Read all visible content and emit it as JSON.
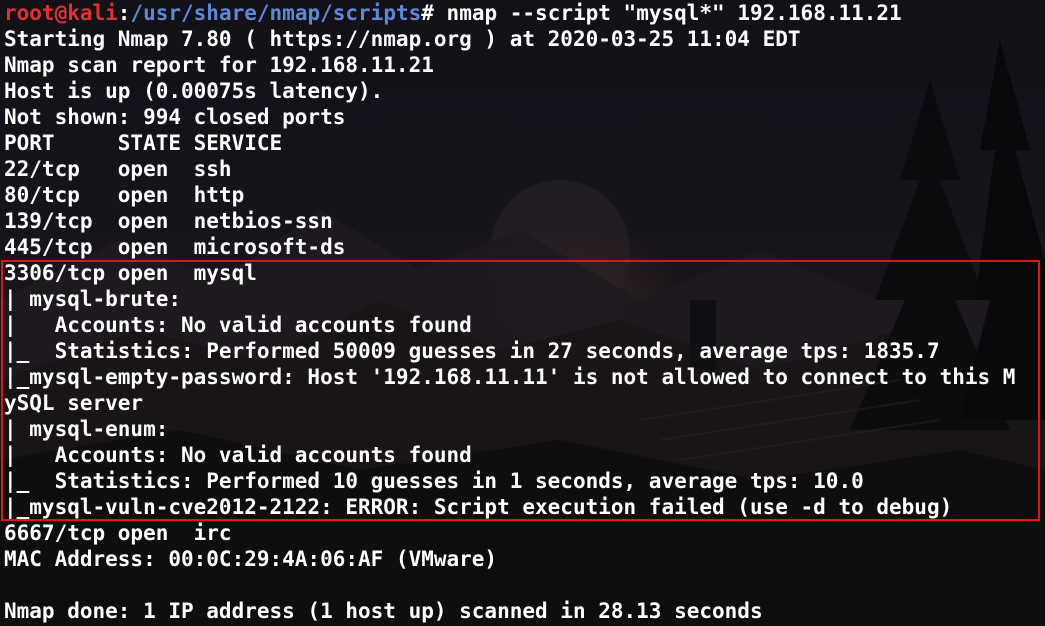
{
  "prompt": {
    "user_host": "root@kali",
    "separator": ":",
    "path": "/usr/share/nmap/scripts",
    "symbol": "#",
    "command": " nmap --script \"mysql*\" 192.168.11.21"
  },
  "output_lines": [
    "Starting Nmap 7.80 ( https://nmap.org ) at 2020-03-25 11:04 EDT",
    "Nmap scan report for 192.168.11.21",
    "Host is up (0.00075s latency).",
    "Not shown: 994 closed ports",
    "PORT     STATE SERVICE",
    "22/tcp   open  ssh",
    "80/tcp   open  http",
    "139/tcp  open  netbios-ssn",
    "445/tcp  open  microsoft-ds",
    "3306/tcp open  mysql",
    "| mysql-brute: ",
    "|   Accounts: No valid accounts found",
    "|_  Statistics: Performed 50009 guesses in 27 seconds, average tps: 1835.7",
    "|_mysql-empty-password: Host '192.168.11.11' is not allowed to connect to this M",
    "ySQL server",
    "| mysql-enum: ",
    "|   Accounts: No valid accounts found",
    "|_  Statistics: Performed 10 guesses in 1 seconds, average tps: 10.0",
    "|_mysql-vuln-cve2012-2122: ERROR: Script execution failed (use -d to debug)",
    "6667/tcp open  irc",
    "MAC Address: 00:0C:29:4A:06:AF (VMware)",
    "",
    "Nmap done: 1 IP address (1 host up) scanned in 28.13 seconds"
  ],
  "colors": {
    "prompt_user": "#e03131",
    "prompt_path": "#5f87d7",
    "text": "#ffffff",
    "highlight_border": "#e01414"
  }
}
